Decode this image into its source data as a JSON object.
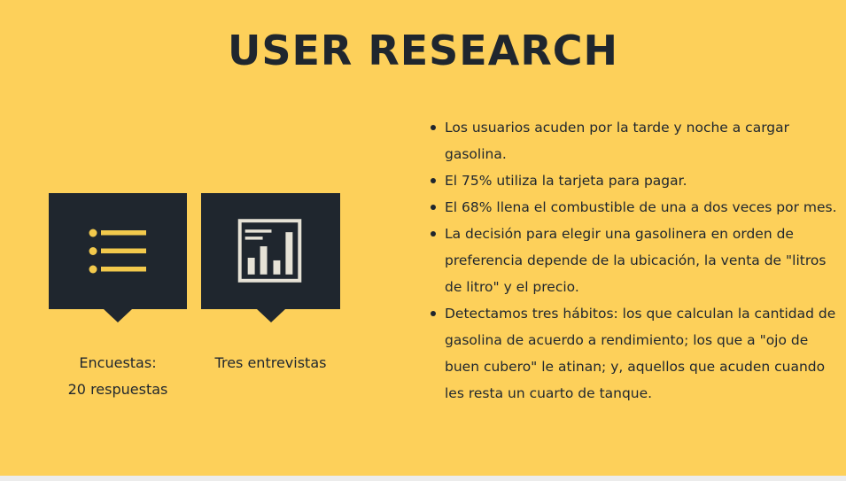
{
  "slide": {
    "title": "USER RESEARCH",
    "colors": {
      "background": "#fdd05a",
      "dark": "#1f262e",
      "accent": "#f2c94c",
      "icon_light": "#e6e2d6"
    }
  },
  "cards": [
    {
      "icon": "list-icon",
      "caption_line1": "Encuestas:",
      "caption_line2": "20 respuestas"
    },
    {
      "icon": "bar-chart-report-icon",
      "caption_line1": "Tres entrevistas"
    }
  ],
  "findings": [
    "Los usuarios acuden por la tarde y noche a cargar gasolina.",
    "El 75% utiliza la tarjeta para pagar.",
    "El 68% llena el combustible de una a dos veces por mes.",
    "La decisión para elegir una gasolinera en orden de preferencia depende de la ubicación, la venta de \"litros de litro\" y el precio.",
    "Detectamos tres hábitos: los que calculan la cantidad de gasolina de acuerdo a rendimiento; los que a \"ojo de buen cubero\" le atinan; y, aquellos que acuden cuando les resta un cuarto de tanque."
  ]
}
